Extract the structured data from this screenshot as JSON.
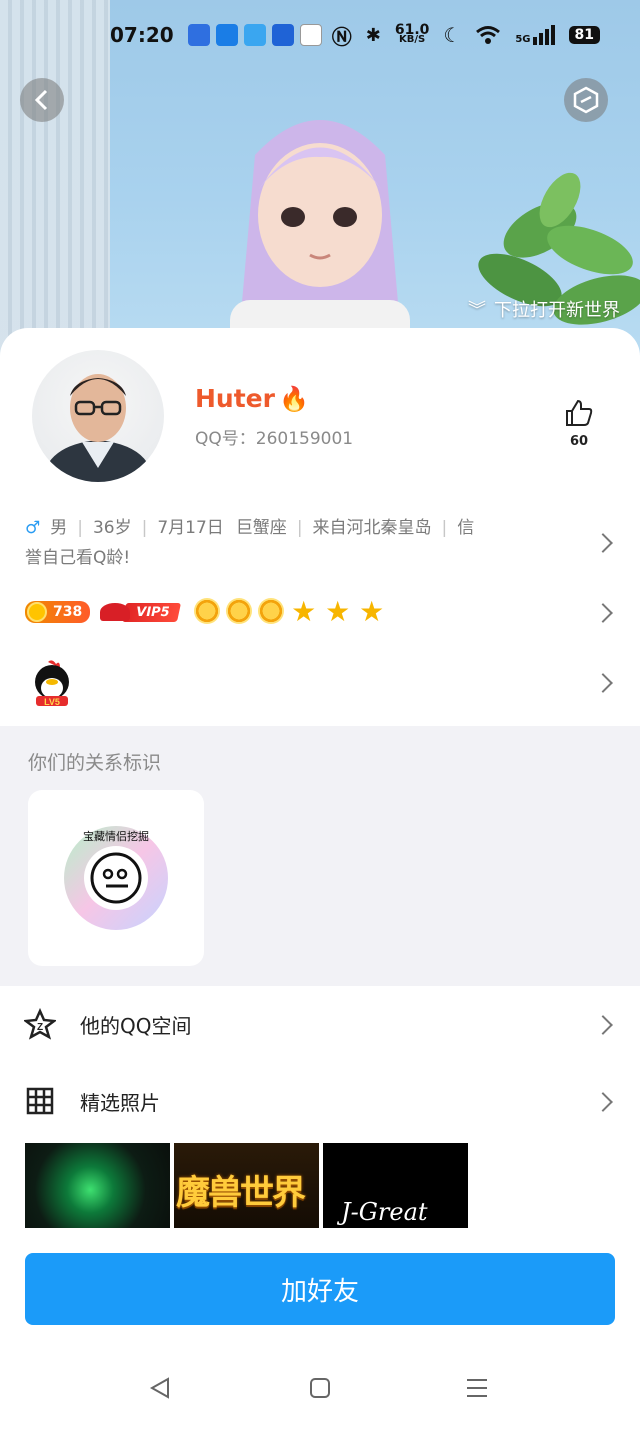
{
  "status_bar": {
    "time": "07:20",
    "net_speed_value": "61.0",
    "net_speed_unit": "KB/S",
    "network": "5G",
    "battery": "81",
    "app_icons": [
      "欧态",
      "手电筒",
      "天气",
      "汽车之家",
      "企鹅"
    ]
  },
  "banner": {
    "pull_hint": "下拉打开新世界"
  },
  "profile": {
    "nickname": "Huter",
    "qq_label": "QQ号：",
    "qq_number": "260159001",
    "likes": "60"
  },
  "info": {
    "gender": "男",
    "age": "36岁",
    "birthday": "7月17日",
    "zodiac": "巨蟹座",
    "location": "来自河北秦皇岛",
    "credit_line1": "信",
    "credit_line2": "誉自己看Q龄!"
  },
  "badges": {
    "coins": "738",
    "vip": "VIP5",
    "level_icons": [
      "sun",
      "sun",
      "sun",
      "star",
      "star",
      "star"
    ]
  },
  "penguin_level": "LV5",
  "relationship": {
    "title": "你们的关系标识",
    "badge_text": "宝藏情侣挖掘"
  },
  "menu": {
    "qzone": "他的QQ空间",
    "photos": "精选照片"
  },
  "photos": [
    {
      "name": "green-warrior-dragon"
    },
    {
      "name": "wow-logo",
      "text": "魔兽世界"
    },
    {
      "name": "j-great",
      "text": "J-Great"
    }
  ],
  "actions": {
    "add_friend": "加好友"
  },
  "colors": {
    "accent": "#1b9bf9",
    "nickname": "#ee5a2c",
    "male": "#2a9cf2"
  }
}
